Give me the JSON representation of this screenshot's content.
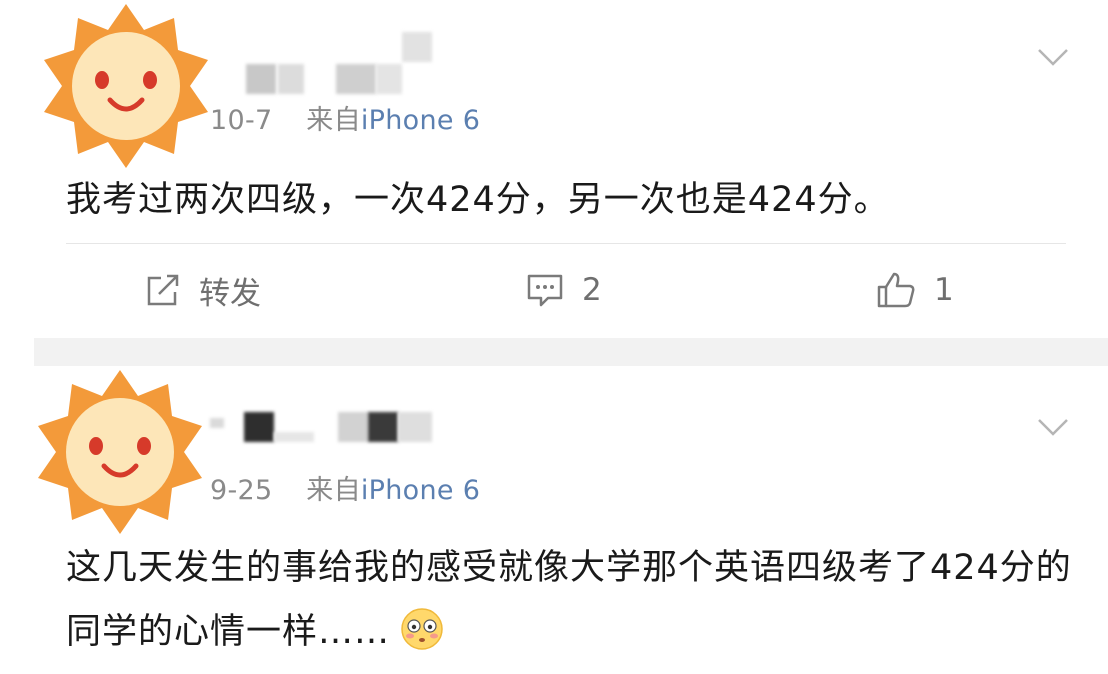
{
  "feed": {
    "posts": [
      {
        "date": "10-7",
        "source_prefix": "来自",
        "source_device": "iPhone 6",
        "content": "我考过两次四级，一次424分，另一次也是424分。",
        "actions": {
          "repost_label": "转发",
          "comment_count": "2",
          "like_count": "1"
        }
      },
      {
        "date": "9-25",
        "source_prefix": "来自",
        "source_device": "iPhone 6",
        "content": "这几天发生的事给我的感受就像大学那个英语四级考了424分的同学的心情一样……"
      }
    ]
  },
  "icons": {
    "avatar": "sun-avatar-icon",
    "more": "chevron-down-icon",
    "repost": "repost-icon",
    "comment": "comment-icon",
    "like": "thumbs-up-icon",
    "emoji": "flushed-face-emoji"
  },
  "colors": {
    "source_link": "#5b7fb0",
    "meta_text": "#8a8a8a",
    "separator": "#f2f2f2",
    "avatar_orange": "#f39a3a",
    "avatar_face": "#fde6b8"
  }
}
